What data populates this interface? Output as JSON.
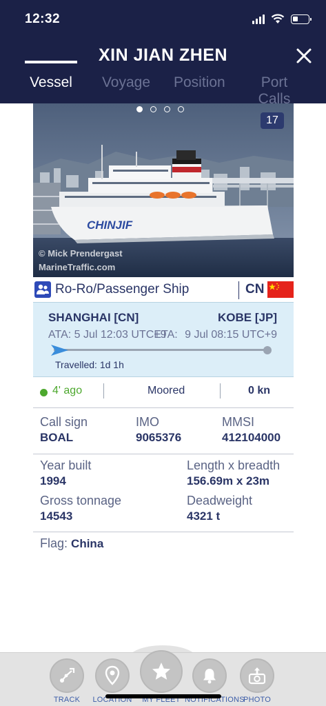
{
  "status_bar": {
    "time": "12:32"
  },
  "header": {
    "title": "XIN JIAN ZHEN",
    "close_icon": "close-icon"
  },
  "tabs": [
    {
      "label": "Vessel",
      "active": true
    },
    {
      "label": "Voyage",
      "active": false
    },
    {
      "label": "Position",
      "active": false
    },
    {
      "label": "Port Calls",
      "active": false
    }
  ],
  "photo": {
    "count": "17",
    "ship_name_on_hull": "CHINJIF",
    "credit": "© Mick Prendergast",
    "source": "MarineTraffic.com",
    "carousel_dots": 4,
    "active_dot": 0
  },
  "vessel": {
    "type": "Ro-Ro/Passenger Ship",
    "flag_code": "CN",
    "flag_color": "#e5231b"
  },
  "voyage": {
    "from_port": "SHANGHAI [CN]",
    "to_port": "KOBE [JP]",
    "ata_label": "ATA:",
    "ata_value": "5 Jul 12:03 UTC+9",
    "eta_label": "ETA:",
    "eta_value": "9 Jul 08:15 UTC+9",
    "travelled": "Travelled: 1d 1h",
    "progress": 0
  },
  "status": {
    "last_seen": "4' ago",
    "nav_status": "Moored",
    "speed": "0 kn"
  },
  "details": {
    "call_sign_label": "Call sign",
    "call_sign": "BOAL",
    "imo_label": "IMO",
    "imo": "9065376",
    "mmsi_label": "MMSI",
    "mmsi": "412104000",
    "year_built_label": "Year built",
    "year_built": "1994",
    "dimensions_label": "Length x breadth",
    "dimensions": "156.69m x 23m",
    "gross_tonnage_label": "Gross tonnage",
    "gross_tonnage": "14543",
    "deadweight_label": "Deadweight",
    "deadweight": "4321 t",
    "flag_label": "Flag:",
    "flag": "China"
  },
  "bottom_nav": [
    {
      "label": "TRACK",
      "icon": "route-icon"
    },
    {
      "label": "LOCATION",
      "icon": "location-pin-icon"
    },
    {
      "label": "MY FLEET",
      "icon": "star-icon"
    },
    {
      "label": "NOTIFICATIONS",
      "icon": "bell-icon"
    },
    {
      "label": "PHOTO",
      "icon": "camera-upload-icon"
    }
  ],
  "colors": {
    "header_bg": "#1b2147",
    "text_primary": "#2a3566",
    "voyage_bg": "#dceef8",
    "online_green": "#4da82e",
    "nav_label_blue": "#3c5da8"
  }
}
